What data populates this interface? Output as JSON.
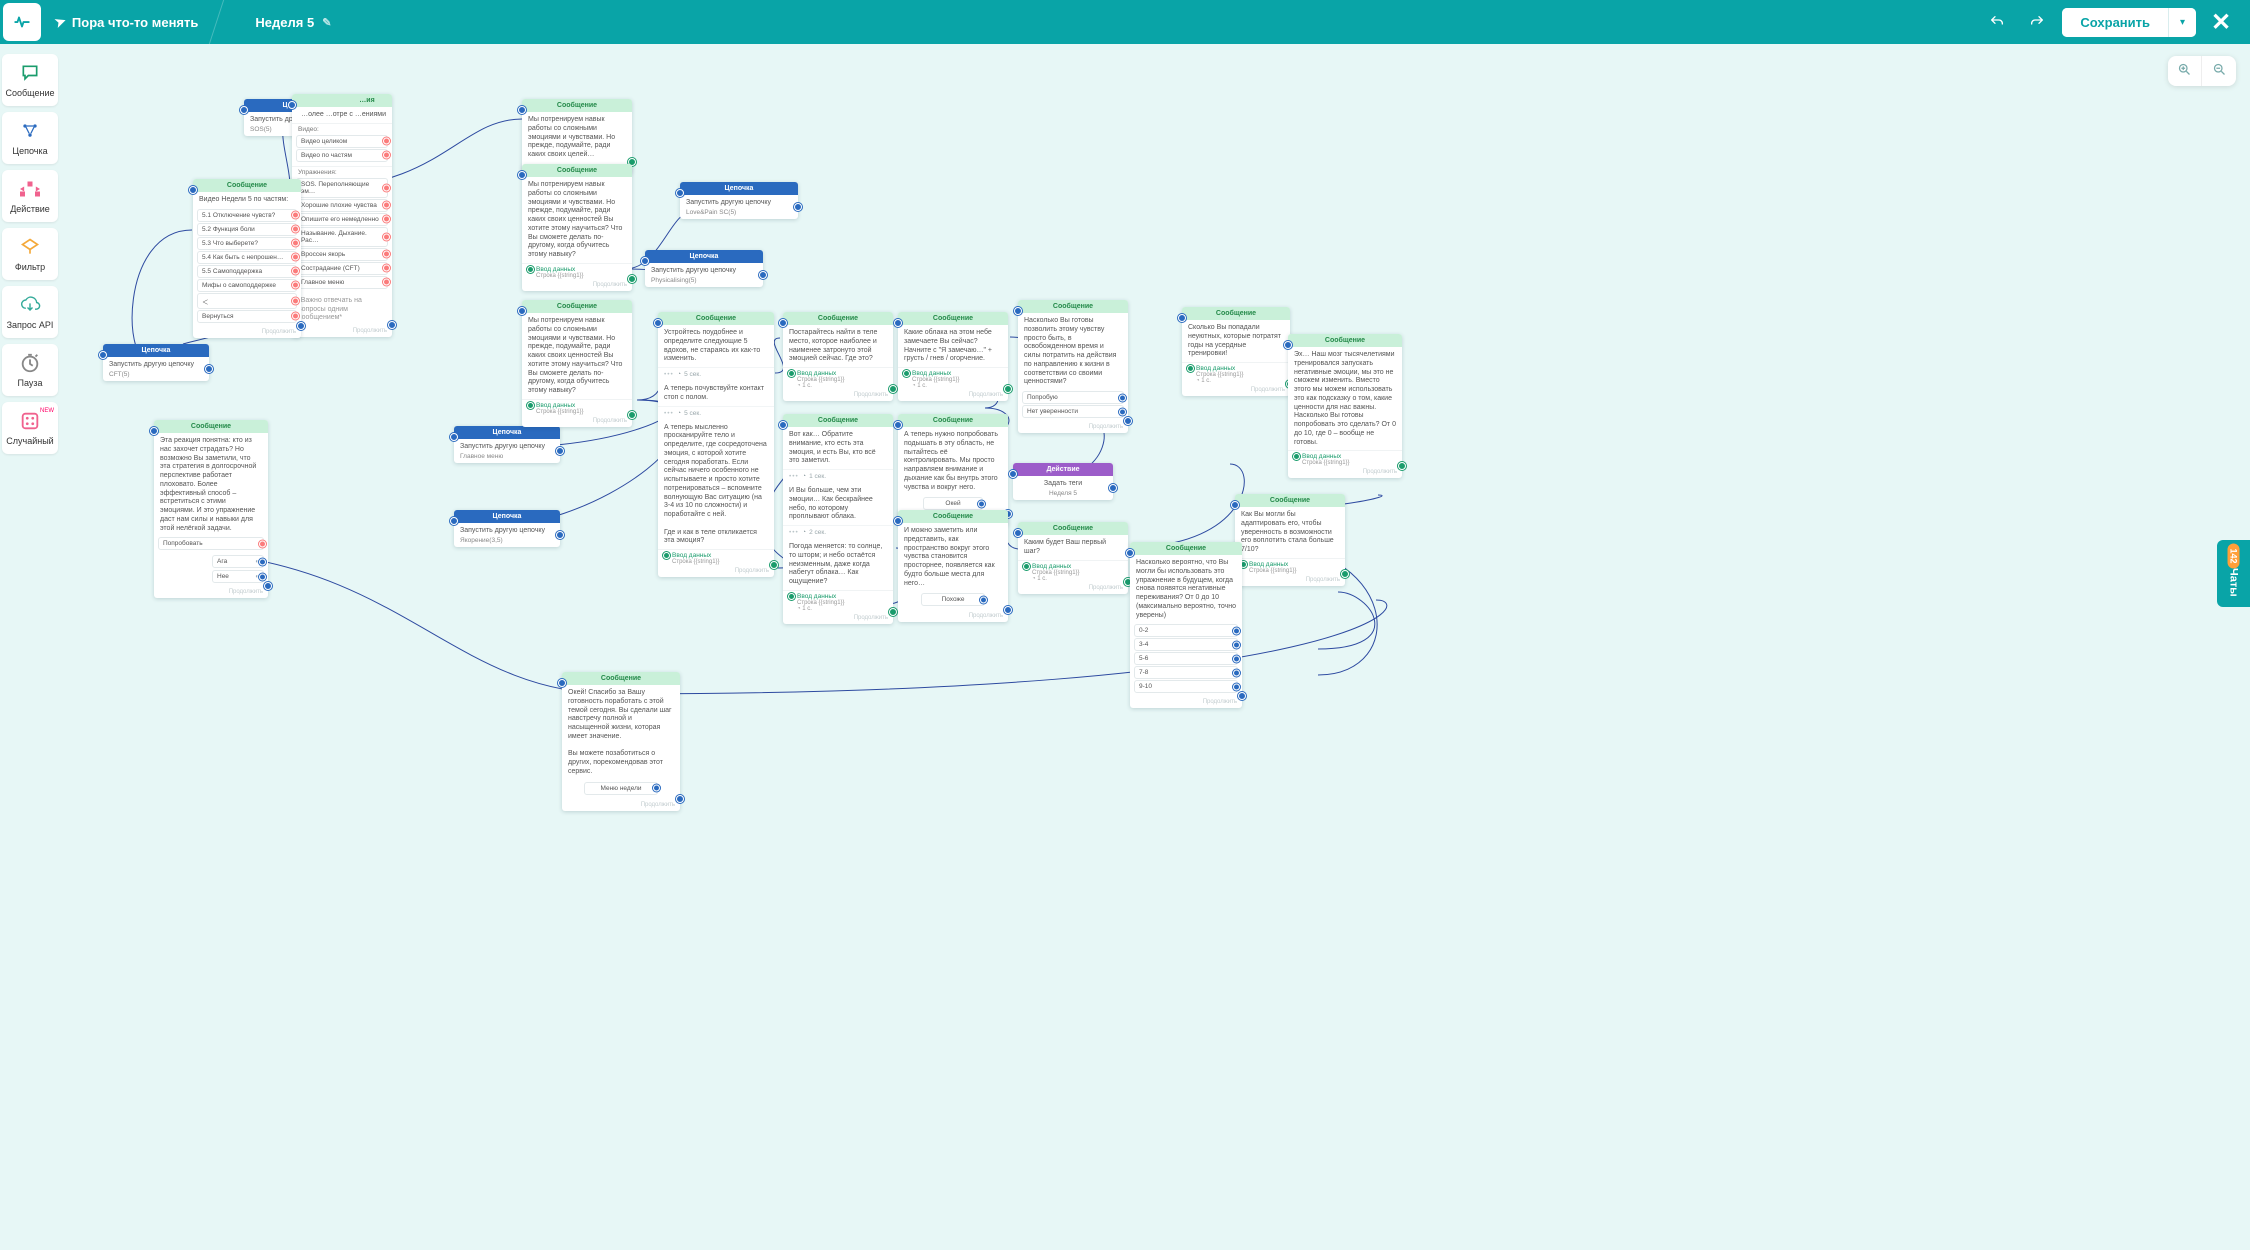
{
  "topbar": {
    "project": "Пора что-то менять",
    "page": "Неделя 5",
    "save": "Сохранить"
  },
  "sidebar": [
    {
      "id": "message",
      "label": "Сообщение",
      "color": "#1a9c6c"
    },
    {
      "id": "chain",
      "label": "Цепочка",
      "color": "#2a6abf"
    },
    {
      "id": "action",
      "label": "Действие",
      "color": "#f0628e"
    },
    {
      "id": "filter",
      "label": "Фильтр",
      "color": "#f4a93a"
    },
    {
      "id": "api",
      "label": "Запрос API",
      "color": "#3a9"
    },
    {
      "id": "pause",
      "label": "Пауза",
      "color": "#888"
    },
    {
      "id": "random",
      "label": "Случайный",
      "color": "#f0628e",
      "badge": "NEW"
    }
  ],
  "zoom": {
    "in": "+",
    "out": "−"
  },
  "chats": {
    "label": "Чаты",
    "count": "142"
  },
  "headers": {
    "msg": "Сообщение",
    "chain": "Цепочка",
    "action": "Действие",
    "input": "Ввод данных",
    "footer": "Продолжить",
    "start": "Запустить другую цепочку",
    "str": "Строка {{string1}}",
    "one": "◔ 1 с."
  },
  "nodes": {
    "n1": {
      "title": "Запустить другую цепочку",
      "sub": "SOS(5)"
    },
    "n2": {
      "lead": "…ия",
      "text": "…олее\n…отре с\n…ениями",
      "sects": [
        "Видео:",
        "Упражнения:"
      ],
      "video": [
        "Видео целиком",
        "Видео по частям"
      ],
      "ex": [
        "SOS. Переполняющие эм…",
        "Хорошие плохие чувства",
        "Опишите его немедленно",
        "Называние. Дыхание. Рас…",
        "Вроссен якорь",
        "Сострадание (CFT)",
        "Главное меню"
      ],
      "foot": "*Важно отвечать на вопросы одним сообщением*"
    },
    "n3": {
      "title": "Видео Недели 5 по частям:",
      "opts": [
        "5.1 Отключение чувств?",
        "5.2 Функция боли",
        "5.3 Что выберете?",
        "5.4 Как быть с непрошен…",
        "5.5 Самоподдержка",
        "Мифы о самоподдержке",
        "＜",
        "Вернуться"
      ]
    },
    "n4": {
      "title": "Запустить другую цепочку",
      "sub": "CFT(5)"
    },
    "n5": {
      "text": "Эта реакция понятна: кто из нас захочет страдать? Но возможно Вы заметили, что эта стратегия в долгосрочной перспективе работает плоховато. Более эффективный способ – встретиться с этими эмоциями. И это упражнение даст нам силы и навыки для этой нелёгкой задачи.",
      "opts": [
        "Попробовать"
      ],
      "yn": [
        "Ага",
        "Нее"
      ]
    },
    "n6": {
      "title": "Запустить другую цепочку",
      "sub": "Главное меню"
    },
    "n7": {
      "title": "Запустить другую цепочку",
      "sub": "Якорение(3,5)"
    },
    "n8": {
      "text": "Мы потренируем навык работы со сложными эмоциями и чувствами. Но прежде, подумайте, ради каких своих целей…"
    },
    "n9": {
      "text": "Мы потренируем навык работы со сложными эмоциями и чувствами. Но прежде, подумайте, ради каких своих ценностей Вы хотите этому научиться? Что Вы сможете делать по-другому, когда обучитесь этому навыку?"
    },
    "n10": {
      "text": "Мы потренируем навык работы со сложными эмоциями и чувствами. Но прежде, подумайте, ради каких своих ценностей Вы хотите этому научиться? Что Вы сможете делать по-другому, когда обучитесь этому навыку?"
    },
    "n11": {
      "title": "Запустить другую цепочку",
      "sub": "Love&Pain SC(5)"
    },
    "n12": {
      "title": "Запустить другую цепочку",
      "sub": "Physicalising(5)"
    },
    "n13": {
      "text": "Устройтесь поудобнее и определите следующие 5 вдохов, не стараясь их как-то изменить.",
      "d1": "5 сек.",
      "t2": "А теперь почувствуйте контакт стоп с полом.",
      "d2": "5 сек.",
      "t3": "А теперь мысленно просканируйте тело и определите, где сосредоточена эмоция, с которой хотите сегодня поработать. Если сейчас ничего особенного не испытываете и просто хотите потренироваться – вспомните волнующую Вас ситуацию (на 3-4 из 10 по сложности) и поработайте с ней.\n\nГде и как в теле откликается эта эмоция?"
    },
    "n14": {
      "text": "Постарайтесь найти в теле место, которое наиболее и наименее затронуто этой эмоцией сейчас. Где это?"
    },
    "n15": {
      "text": "Вот как… Обратите внимание, кто есть эта эмоция, и есть Вы, кто всё это заметил.",
      "d1": "1 сек.",
      "t2": "И Вы больше, чем эти эмоции… Как бескрайнее небо, по которому проплывают облака.",
      "d2": "2 сек.",
      "t3": "Погода меняется: то солнце, то шторм; и небо остаётся неизменным, даже когда набегут облака… Как ощущение?"
    },
    "n16": {
      "text": "Какие облака на этом небе замечаете Вы сейчас? Начните с \"Я замечаю…\" + грусть / гнев / огорчение."
    },
    "n17": {
      "text": "А теперь нужно попробовать подышать в эту область, не пытайтесь её контролировать. Мы просто направляем внимание и дыхание как бы внутрь этого чувства и вокруг него.",
      "opts": [
        "Окей"
      ]
    },
    "n18": {
      "text": "И можно заметить или представить, как пространство вокруг этого чувства становится просторнее, появляется как будто больше места для него…",
      "opts": [
        "Похоже"
      ]
    },
    "n19": {
      "text": "Насколько Вы готовы позволить этому чувству просто быть, в освобожденном время и силы потратить на действия по направлению к жизни в соответствии со своими ценностями?",
      "opts": [
        "Попробую",
        "Нет уверенности"
      ]
    },
    "n20": {
      "title": "Задать теги",
      "sub": "Неделя 5"
    },
    "n21": {
      "text": "Каким будет Ваш первый шаг?"
    },
    "n22": {
      "text": "Сколько Вы попадали неуютных, которые потратят годы на усердные тренировки!"
    },
    "n23": {
      "text": "Эх… Наш мозг тысячелетиями тренировался запускать негативные эмоции, мы это не сможем изменить. Вместо этого мы можем использовать это как подсказку о том, какие ценности для нас важны. Насколько Вы готовы попробовать это сделать? От 0 до 10, где 0 – вообще не готовы."
    },
    "n24": {
      "text": "Как Вы могли бы адаптировать его, чтобы уверенность в возможности его воплотить стала больше 7/10?"
    },
    "n25": {
      "text": "Насколько вероятно, что Вы могли бы использовать это упражнение в будущем, когда снова появятся негативные переживания? От 0 до 10 (максимально вероятно, точно уверены)",
      "opts": [
        "0-2",
        "3-4",
        "5-6",
        "7-8",
        "9-10"
      ]
    },
    "n26": {
      "text": "Окей! Спасибо за Вашу готовность поработать с этой темой сегодня. Вы сделали шаг навстречу полной и насыщенной жизни, которая имеет значение.\n\nВы можете позаботиться о других, порекомендовав этот сервис.",
      "opts": [
        "Меню недели"
      ]
    }
  }
}
